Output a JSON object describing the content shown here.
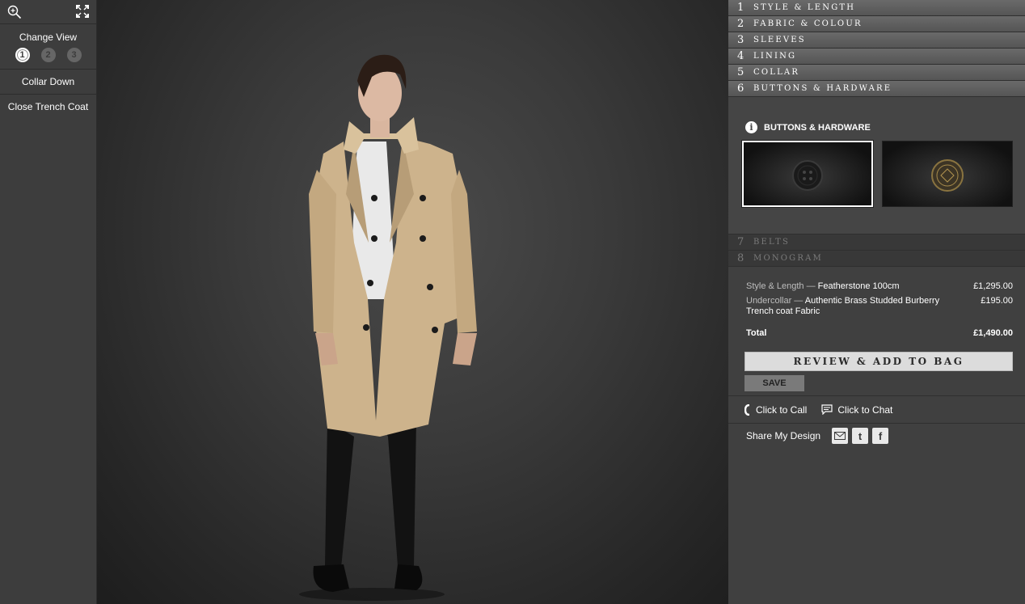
{
  "left": {
    "change_view_label": "Change View",
    "views": [
      "1",
      "2",
      "3"
    ],
    "active_view": "1",
    "options": [
      "Collar Down",
      "Close Trench Coat"
    ]
  },
  "steps_top": [
    {
      "num": "1",
      "label": "Style & Length"
    },
    {
      "num": "2",
      "label": "Fabric & Colour"
    },
    {
      "num": "3",
      "label": "Sleeves"
    },
    {
      "num": "4",
      "label": "Lining"
    },
    {
      "num": "5",
      "label": "Collar"
    },
    {
      "num": "6",
      "label": "Buttons & Hardware"
    }
  ],
  "expanded": {
    "title": "BUTTONS & HARDWARE",
    "selected_swatch": 1
  },
  "steps_bottom": [
    {
      "num": "7",
      "label": "Belts"
    },
    {
      "num": "8",
      "label": "Monogram"
    }
  ],
  "summary": {
    "lines": [
      {
        "key": "Style & Length —",
        "value": "Featherstone 100cm",
        "price": "£1,295.00"
      },
      {
        "key": "Undercollar —",
        "value": "Authentic Brass Studded Burberry Trench coat Fabric",
        "price": "£195.00"
      }
    ],
    "total_label": "Total",
    "total_price": "£1,490.00",
    "review_label": "Review & Add to Bag",
    "save_label": "SAVE"
  },
  "contact": {
    "call_label": "Click to Call",
    "chat_label": "Click to Chat",
    "share_label": "Share My Design"
  },
  "icons": [
    "zoom-icon",
    "fullscreen-icon",
    "info-icon",
    "phone-icon",
    "chat-icon",
    "email-icon",
    "twitter-icon",
    "facebook-icon"
  ],
  "colors": {
    "panel": "#404040",
    "sidebar": "#3d3d3d",
    "coat": "#cdb38c"
  }
}
